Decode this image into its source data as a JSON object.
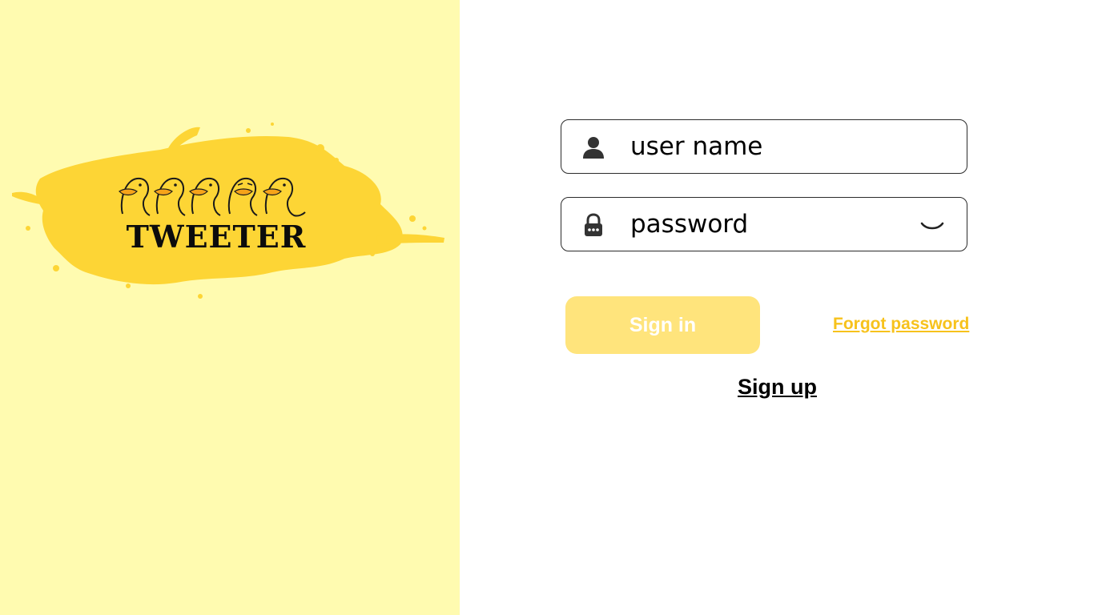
{
  "brand": {
    "name": "TWEETER",
    "logo_icon": "duck-row-logo",
    "splash_color": "#fdd535",
    "panel_color": "#fffbb0"
  },
  "login_form": {
    "username": {
      "placeholder": "user name",
      "value": "",
      "icon": "user-icon"
    },
    "password": {
      "placeholder": "password",
      "value": "",
      "icon": "lock-icon",
      "toggle_icon": "eye-closed-icon"
    },
    "sign_in_label": "Sign in",
    "sign_in_color": "#ffe47c",
    "forgot_label": "Forgot password",
    "forgot_color": "#f7c21c",
    "sign_up_label": "Sign up"
  }
}
